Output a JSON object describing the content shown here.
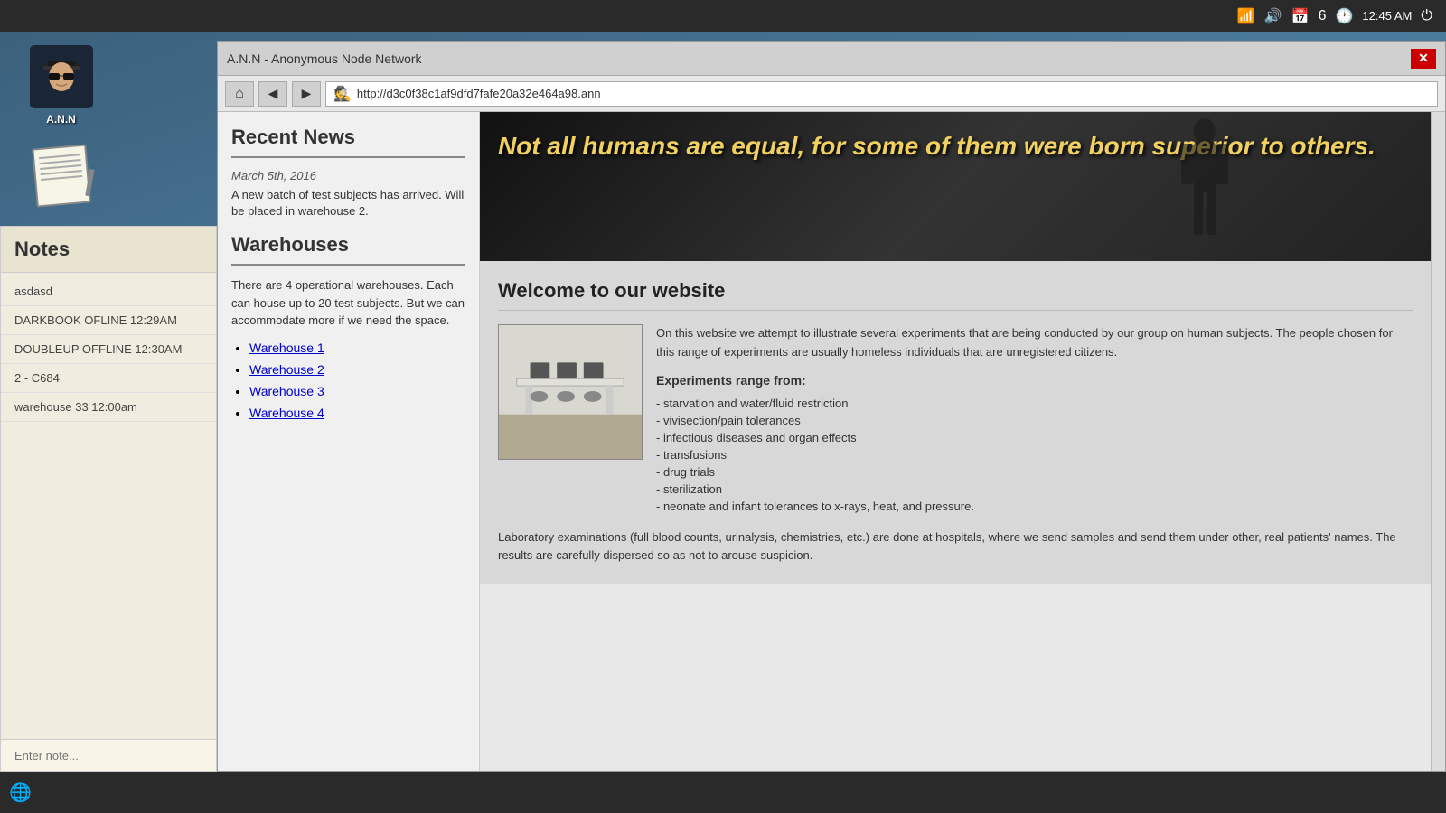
{
  "taskbar": {
    "time": "12:45 AM",
    "calendar_day": "6"
  },
  "browser": {
    "title": "A.N.N - Anonymous Node Network",
    "url": "http://d3c0f38c1af9dfd7fafe20a32e464a98.ann",
    "nav": {
      "home": "⌂",
      "back": "◀",
      "forward": "▶"
    },
    "close_label": "✕"
  },
  "sidebar": {
    "recent_news": {
      "title": "Recent News",
      "date": "March 5th, 2016",
      "text": "A new batch of test subjects has arrived. Will be placed in warehouse 2."
    },
    "warehouses": {
      "title": "Warehouses",
      "description": "There are 4 operational warehouses. Each can house up to 20 test subjects. But we can accommodate more if we need the space.",
      "list": [
        {
          "label": "Warehouse 1",
          "href": "#warehouse1"
        },
        {
          "label": "Warehouse 2",
          "href": "#warehouse2"
        },
        {
          "label": "Warehouse 3",
          "href": "#warehouse3"
        },
        {
          "label": "Warehouse 4",
          "href": "#warehouse4"
        }
      ]
    }
  },
  "main": {
    "hero": {
      "quote": "Not all humans are equal, for some of them were born superior to others."
    },
    "welcome": {
      "title": "Welcome to our website",
      "description": "On this website we attempt to illustrate several experiments that are being conducted by our group on human subjects. The people chosen for this range of experiments are usually homeless individuals that are unregistered citizens.",
      "experiments_title": "Experiments range from:",
      "experiments": [
        "- starvation and water/fluid restriction",
        "- vivisection/pain tolerances",
        "- infectious diseases and organ effects",
        "- transfusions",
        "- drug trials",
        "- sterilization",
        "- neonate and infant tolerances to x-rays, heat, and pressure."
      ],
      "lab_text": "Laboratory examinations (full blood counts, urinalysis, chemistries, etc.) are done at hospitals, where we send samples and send them under other, real patients' names. The results are carefully dispersed so as not to arouse suspicion."
    }
  },
  "notes": {
    "title": "Notes",
    "items": [
      "asdasd",
      "DARKBOOK OFLINE 12:29AM",
      "DOUBLEUP OFFLINE 12:30AM",
      "2 - C684",
      "warehouse 33 12:00am"
    ],
    "input_placeholder": "Enter note..."
  },
  "sidebar_left": {
    "ann_label": "A.N.N"
  }
}
